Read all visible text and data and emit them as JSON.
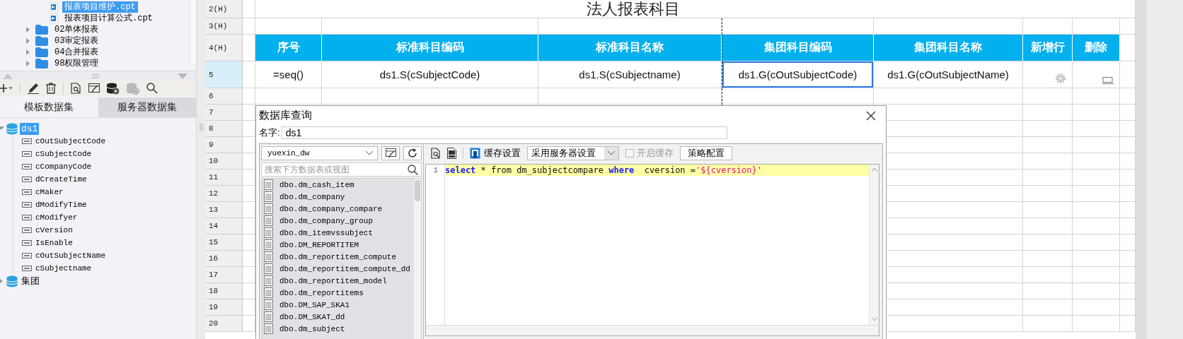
{
  "file_tree": [
    {
      "label": "报表项目维护.cpt",
      "kind": "file",
      "selected": true
    },
    {
      "label": "报表项目计算公式.cpt",
      "kind": "file",
      "selected": false
    },
    {
      "label": "02单体报表",
      "kind": "folder",
      "selected": false,
      "expanded": false
    },
    {
      "label": "03审定报表",
      "kind": "folder",
      "selected": false,
      "expanded": false
    },
    {
      "label": "04合并报表",
      "kind": "folder",
      "selected": false,
      "expanded": false
    },
    {
      "label": "98权限管理",
      "kind": "folder",
      "selected": false,
      "expanded": false
    }
  ],
  "dataset_tabs": [
    {
      "label": "模板数据集",
      "selected": true
    },
    {
      "label": "服务器数据集",
      "selected": false
    }
  ],
  "datasets": [
    {
      "label": "ds1",
      "selected": true,
      "expanded": true,
      "children": [
        {
          "label": "cOutSubjectCode"
        },
        {
          "label": "cSubjectCode"
        },
        {
          "label": "cCompanyCode"
        },
        {
          "label": "dCreateTime"
        },
        {
          "label": "cMaker"
        },
        {
          "label": "dModifyTime"
        },
        {
          "label": "cModifyer"
        },
        {
          "label": "cVersion"
        },
        {
          "label": "IsEnable"
        },
        {
          "label": "cOutSubjectName"
        },
        {
          "label": "cSubjectname"
        }
      ]
    },
    {
      "label": "集团",
      "selected": false,
      "expanded": false
    }
  ],
  "sheet": {
    "rows": [
      {
        "header": "2(H)",
        "selected": false,
        "kind": "title",
        "title": "法人报表科目"
      },
      {
        "header": "3(H)",
        "selected": false,
        "kind": "empty"
      },
      {
        "header": "4(H)",
        "selected": false,
        "kind": "header",
        "cells": [
          "序号",
          "标准科目编码",
          "标准科目名称",
          "集团科目编码",
          "集团科目名称",
          "新增行",
          "删除"
        ]
      },
      {
        "header": "5",
        "selected": true,
        "kind": "formula",
        "cells": [
          {
            "text": "=seq()",
            "selected": false
          },
          {
            "text": "ds1.S(cSubjectCode)",
            "selected": false
          },
          {
            "text": "ds1.S(cSubjectname)",
            "selected": false
          },
          {
            "text": "ds1.G(cOutSubjectCode)",
            "selected": true
          },
          {
            "text": "ds1.G(cOutSubjectName)",
            "selected": false
          }
        ]
      },
      {
        "header": "6",
        "selected": false,
        "kind": "empty"
      },
      {
        "header": "7",
        "selected": false,
        "kind": "empty"
      },
      {
        "header": "8",
        "selected": false,
        "kind": "empty"
      },
      {
        "header": "9",
        "selected": false,
        "kind": "empty"
      },
      {
        "header": "10",
        "selected": false,
        "kind": "empty"
      },
      {
        "header": "11",
        "selected": false,
        "kind": "empty"
      },
      {
        "header": "12",
        "selected": false,
        "kind": "empty"
      },
      {
        "header": "13",
        "selected": false,
        "kind": "empty"
      },
      {
        "header": "14",
        "selected": false,
        "kind": "empty"
      },
      {
        "header": "15",
        "selected": false,
        "kind": "empty"
      },
      {
        "header": "16",
        "selected": false,
        "kind": "empty"
      },
      {
        "header": "17",
        "selected": false,
        "kind": "empty"
      },
      {
        "header": "18",
        "selected": false,
        "kind": "empty"
      },
      {
        "header": "19",
        "selected": false,
        "kind": "empty"
      },
      {
        "header": "20",
        "selected": false,
        "kind": "empty"
      }
    ]
  },
  "dialog": {
    "title": "数据库查询",
    "name_label": "名字:",
    "name_value": "ds1",
    "connection": "yuexin_dw",
    "search_placeholder": "搜索下方数据表或视图",
    "tables": [
      {
        "label": "dbo.dm_cash_item"
      },
      {
        "label": "dbo.dm_company"
      },
      {
        "label": "dbo.dm_company_compare"
      },
      {
        "label": "dbo.dm_company_group"
      },
      {
        "label": "dbo.dm_itemvssubject"
      },
      {
        "label": "dbo.DM_REPORTITEM"
      },
      {
        "label": "dbo.dm_reportitem_compute"
      },
      {
        "label": "dbo.dm_reportitem_compute_dd"
      },
      {
        "label": "dbo.dm_reportitem_model"
      },
      {
        "label": "dbo.dm_reportitems"
      },
      {
        "label": "dbo.DM_SAP_SKA1"
      },
      {
        "label": "dbo.DM_SKAT_dd"
      },
      {
        "label": "dbo.dm_subject"
      }
    ],
    "cache_label": "缓存设置",
    "cache_mode": "采用服务器设置",
    "enable_cache": {
      "label": "开启缓存",
      "checked": false,
      "disabled": true
    },
    "policy_button": "策略配置",
    "sql_lines": [
      {
        "number": "1",
        "tokens": [
          {
            "text": "select",
            "kind": "keyword"
          },
          {
            "text": " * from dm_subjectcompare ",
            "kind": "plain"
          },
          {
            "text": "where",
            "kind": "keyword"
          },
          {
            "text": "  cversion =",
            "kind": "plain"
          },
          {
            "text": "'${cversion}'",
            "kind": "string"
          }
        ]
      }
    ]
  }
}
